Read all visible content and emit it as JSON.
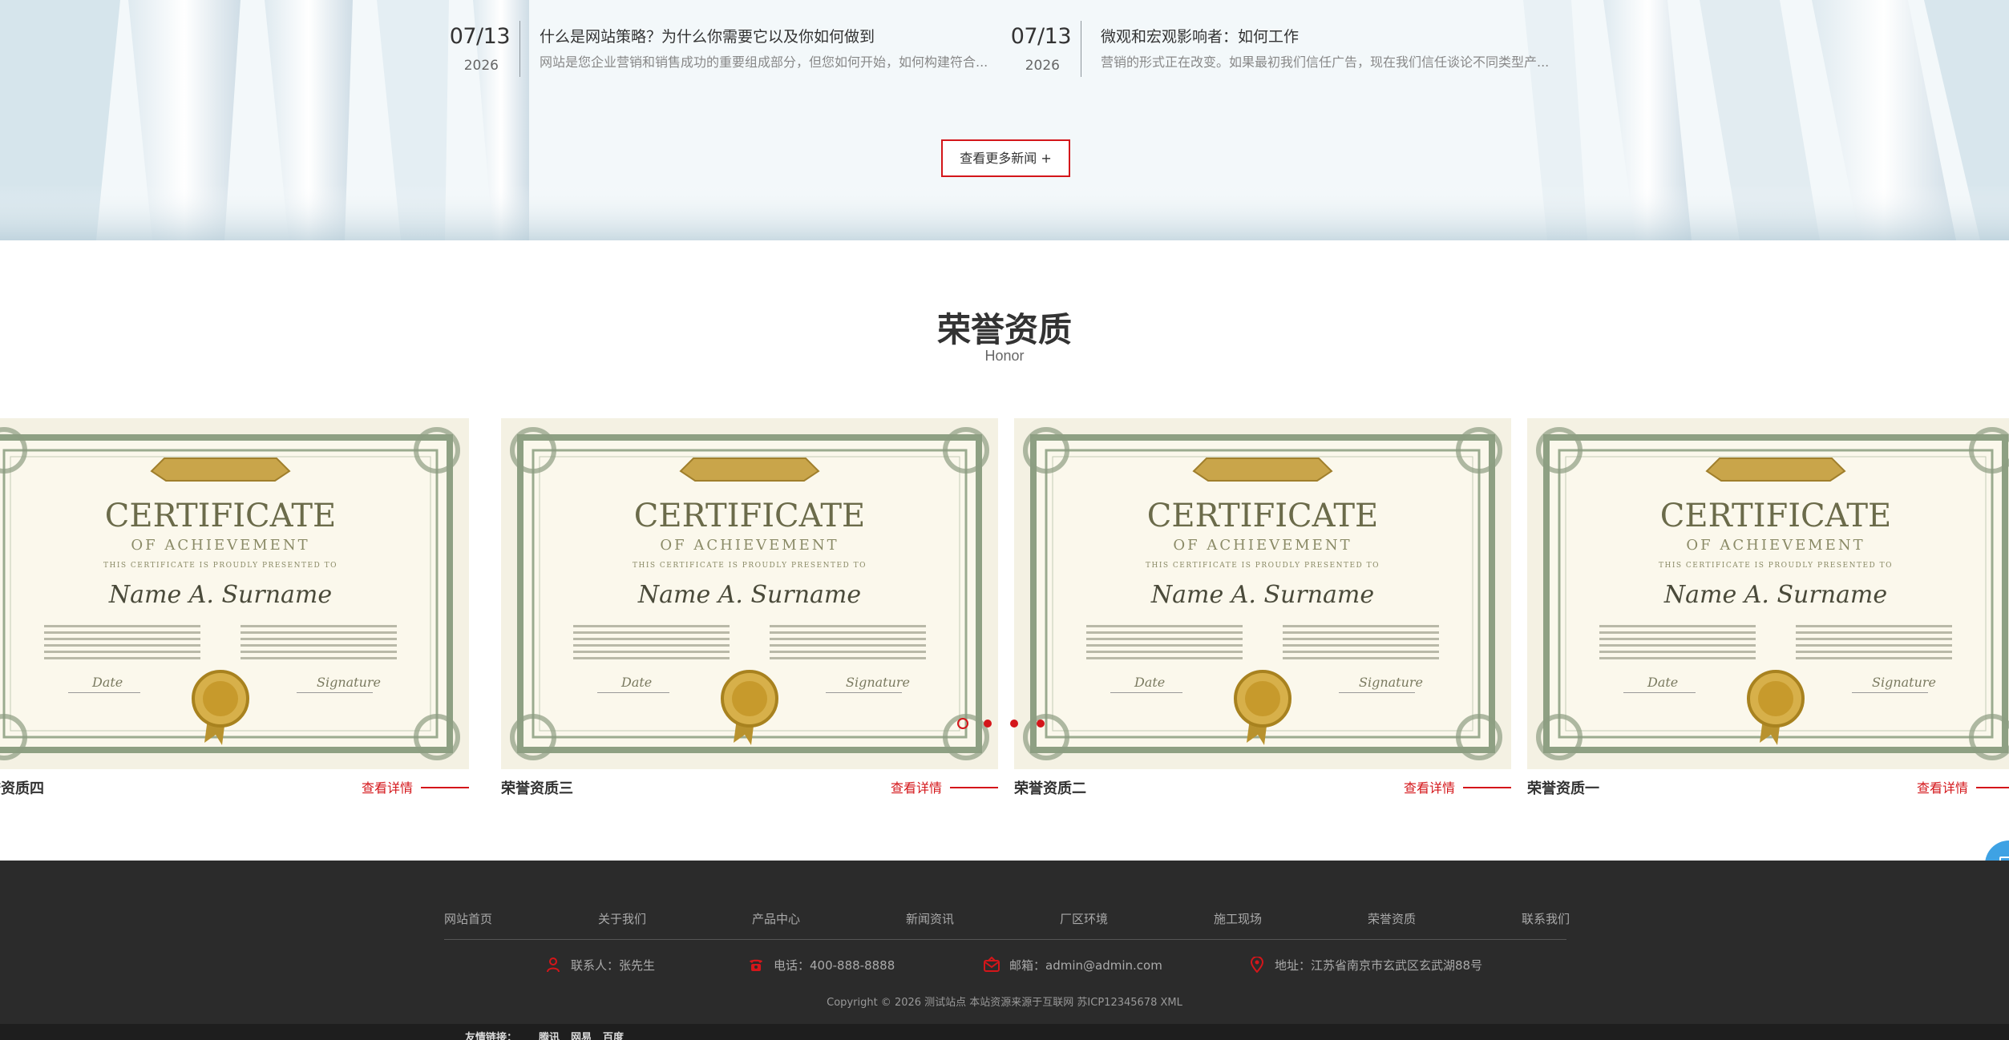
{
  "news": [
    {
      "day": "07/13",
      "year": "2026",
      "title": "什么是网站策略？为什么你需要它以及你如何做到",
      "summary": "网站是您企业营销和销售成功的重要组成部分，但您如何开始，如何构建符合..."
    },
    {
      "day": "07/13",
      "year": "2026",
      "title": "微观和宏观影响者：如何工作",
      "summary": "营销的形式正在改变。如果最初我们信任广告，现在我们信任谈论不同类型产..."
    }
  ],
  "more_news_label": "查看更多新闻 +",
  "honor": {
    "title": "荣誉资质",
    "subtitle": "Honor",
    "certificate": {
      "heading": "CERTIFICATE",
      "subheading": "OF ACHIEVEMENT",
      "presented": "THIS CERTIFICATE IS PROUDLY PRESENTED TO",
      "name": "Name A. Surname",
      "date_label": "Date",
      "signature_label": "Signature"
    },
    "items": [
      {
        "caption": "荣誉资质四",
        "detail": "查看详情"
      },
      {
        "caption": "荣誉资质三",
        "detail": "查看详情"
      },
      {
        "caption": "荣誉资质二",
        "detail": "查看详情"
      },
      {
        "caption": "荣誉资质一",
        "detail": "查看详情"
      }
    ],
    "active_dot": 0,
    "dot_count": 4
  },
  "footer": {
    "nav": [
      "网站首页",
      "关于我们",
      "产品中心",
      "新闻资讯",
      "厂区环境",
      "施工现场",
      "荣誉资质",
      "联系我们"
    ],
    "contacts": [
      {
        "icon": "person-icon",
        "text": "联系人：张先生"
      },
      {
        "icon": "phone-icon",
        "text": "电话：400-888-8888"
      },
      {
        "icon": "mail-icon",
        "text": "邮箱：admin@admin.com"
      },
      {
        "icon": "location-pin-icon",
        "text": "地址：江苏省南京市玄武区玄武湖88号"
      }
    ],
    "copyright": "Copyright © 2026 测试站点 本站资源来源于互联网 苏ICP12345678 XML",
    "links_label": "友情链接：",
    "links": [
      "腾讯",
      "网易",
      "百度"
    ]
  },
  "colors": {
    "accent": "#d4161a",
    "footer_bg": "#2b2b2b",
    "side_tool": "#3ea2e4"
  }
}
